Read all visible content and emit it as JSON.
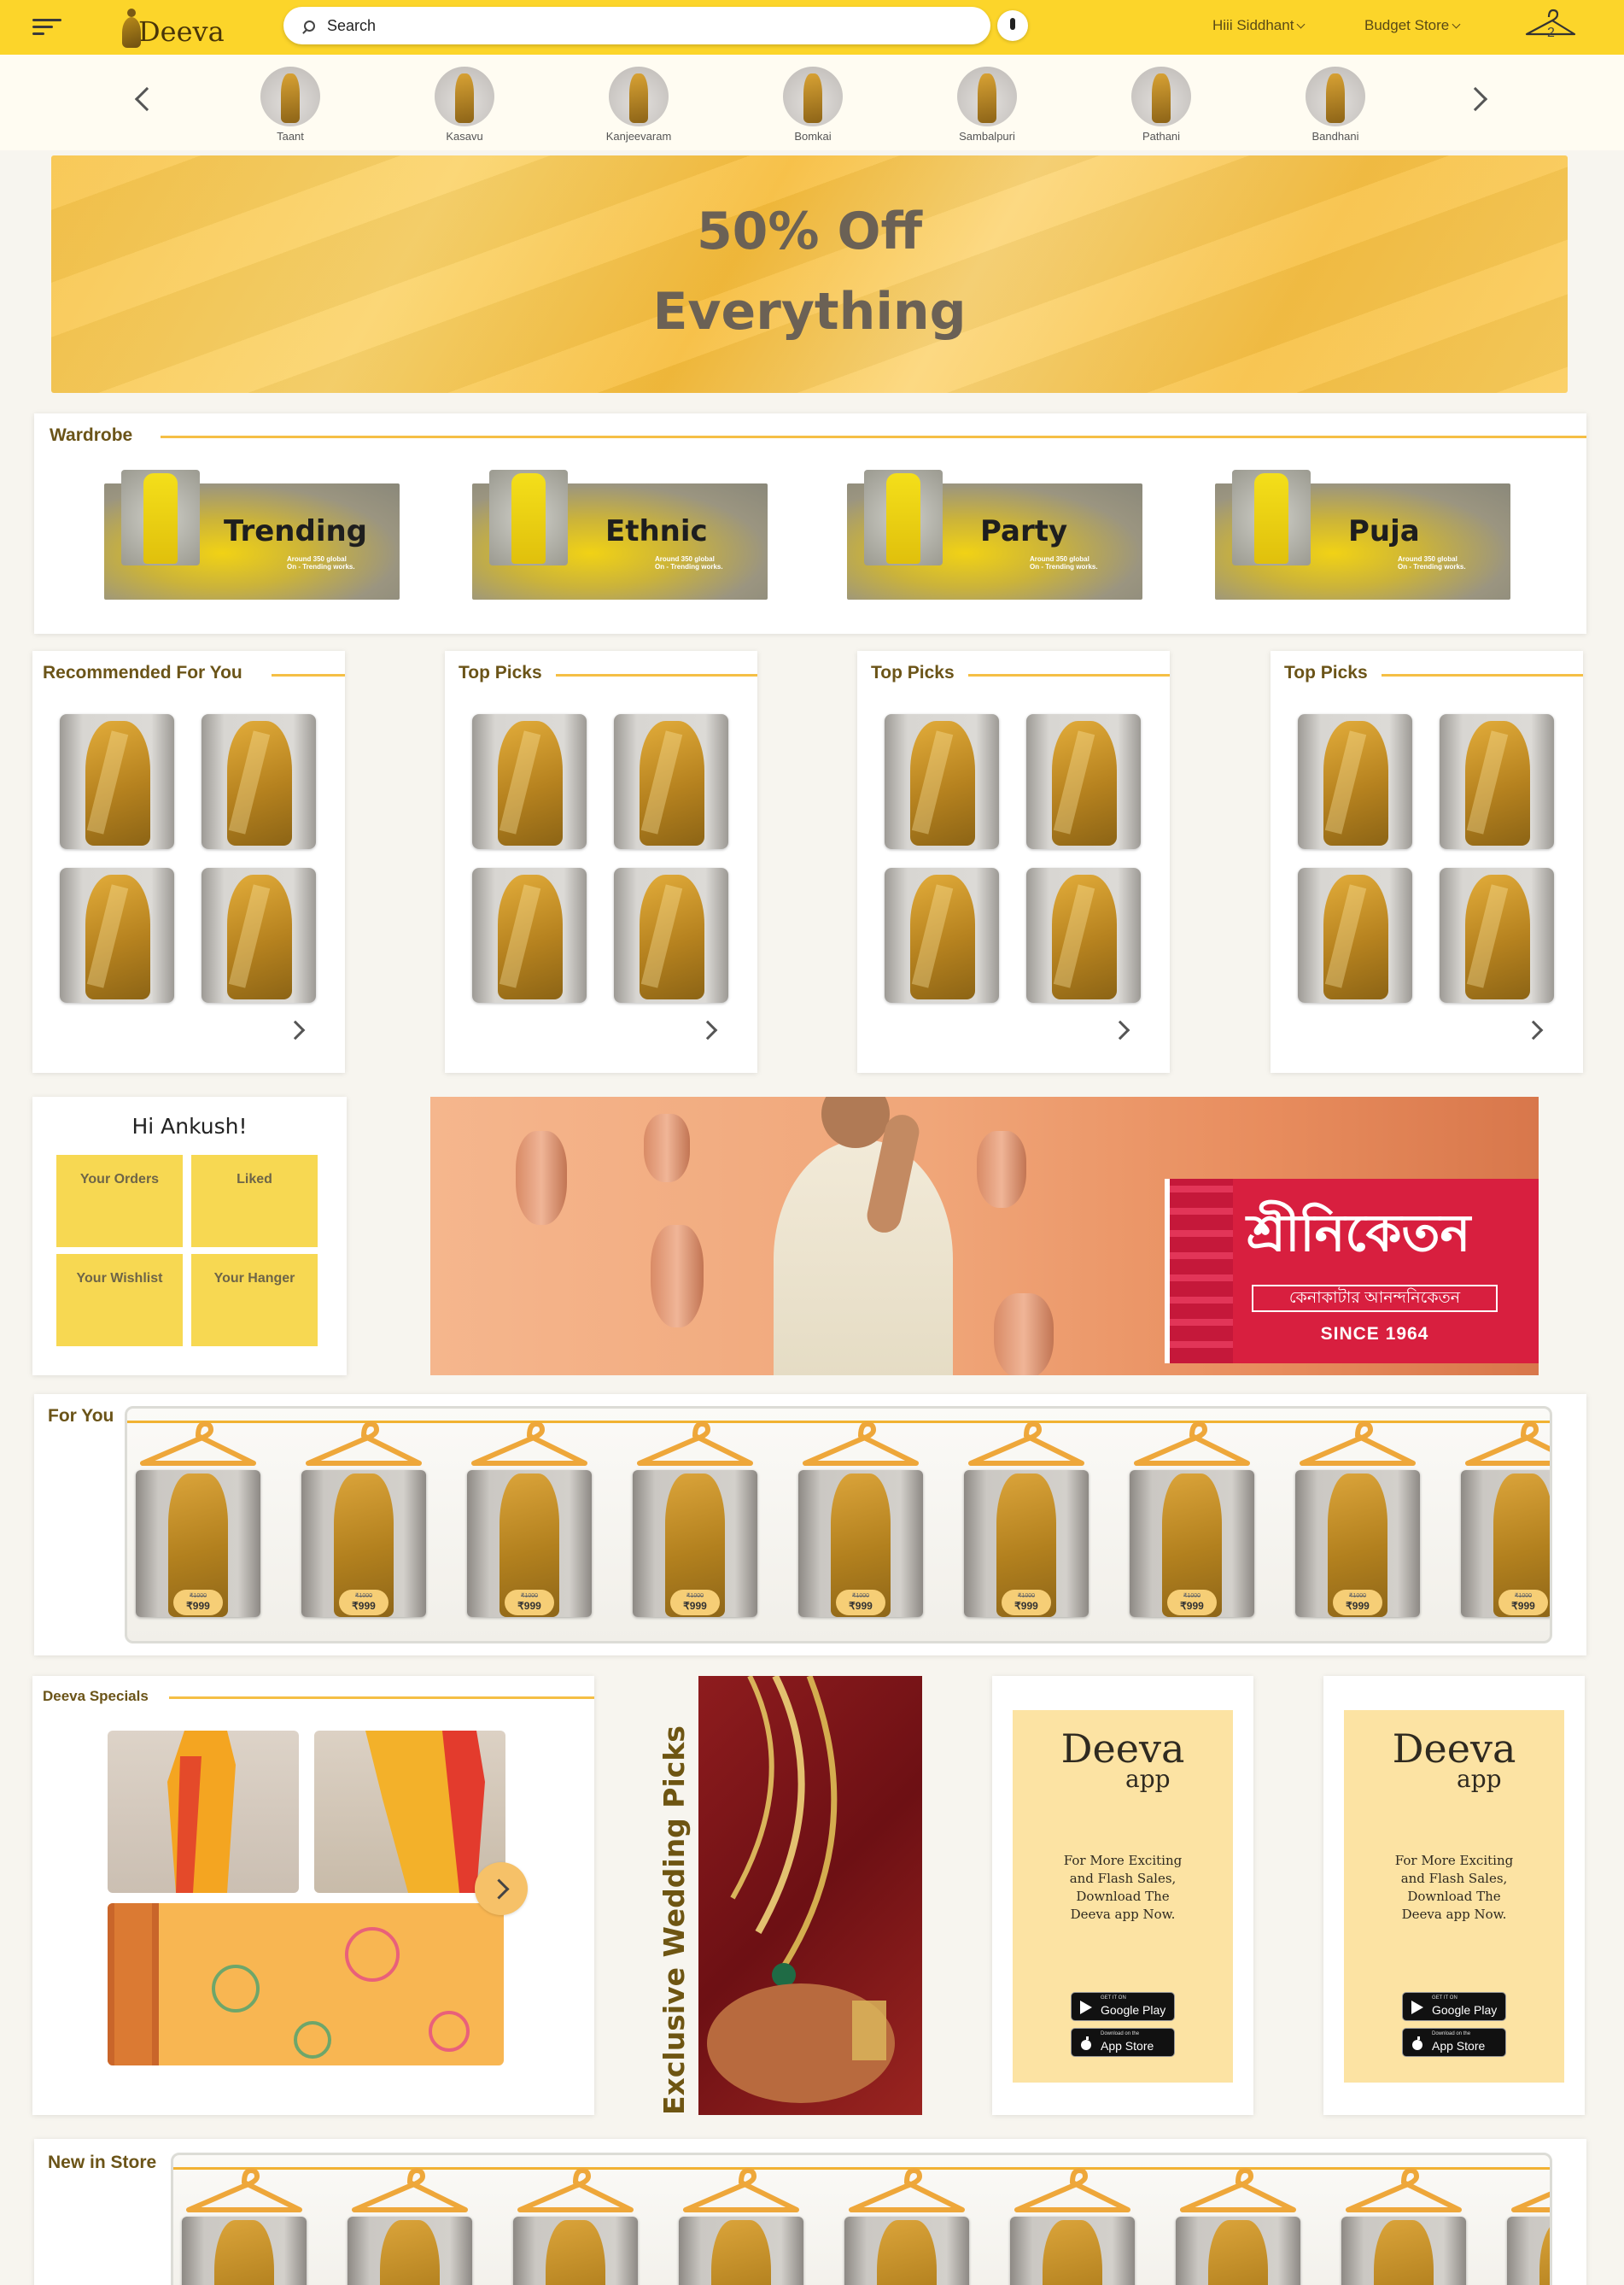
{
  "header": {
    "brand": "Deeva",
    "search_placeholder": "Search",
    "user_menu": "Hiii Siddhant",
    "store_menu": "Budget Store",
    "hanger_count": "2"
  },
  "categories": [
    "Taant",
    "Kasavu",
    "Kanjeevaram",
    "Bomkai",
    "Sambalpuri",
    "Pathani",
    "Bandhani"
  ],
  "hero": {
    "line1": "50% Off",
    "line2": "Everything"
  },
  "wardrobe": {
    "title": "Wardrobe",
    "items": [
      {
        "label": "Trending",
        "sub1": "Around 350 global",
        "sub2": "On - Trending works."
      },
      {
        "label": "Ethnic",
        "sub1": "Around 350 global",
        "sub2": "On - Trending works."
      },
      {
        "label": "Party",
        "sub1": "Around 350 global",
        "sub2": "On - Trending works."
      },
      {
        "label": "Puja",
        "sub1": "Around 350 global",
        "sub2": "On - Trending works."
      }
    ]
  },
  "pick_cards": [
    {
      "title": "Recommended For You"
    },
    {
      "title": "Top Picks"
    },
    {
      "title": "Top Picks"
    },
    {
      "title": "Top Picks"
    }
  ],
  "greeting": {
    "title": "Hi Ankush!",
    "tiles": [
      "Your Orders",
      "Liked",
      "Your Wishlist",
      "Your Hanger"
    ]
  },
  "banner": {
    "brand_bengali": "শ্রীনিকেতন",
    "tagline_bengali": "কেনাকাটার আনন্দনিকেতন",
    "since": "SINCE 1964"
  },
  "for_you": {
    "title": "For You",
    "items": [
      {
        "old_price": "₹1000",
        "price": "₹999"
      },
      {
        "old_price": "₹1000",
        "price": "₹999"
      },
      {
        "old_price": "₹1000",
        "price": "₹999"
      },
      {
        "old_price": "₹1000",
        "price": "₹999"
      },
      {
        "old_price": "₹1000",
        "price": "₹999"
      },
      {
        "old_price": "₹1000",
        "price": "₹999"
      },
      {
        "old_price": "₹1000",
        "price": "₹999"
      },
      {
        "old_price": "₹1000",
        "price": "₹999"
      },
      {
        "old_price": "₹1000",
        "price": "₹999"
      }
    ]
  },
  "specials": {
    "title": "Deeva Specials"
  },
  "wedding": {
    "label": "Exclusive Wedding Picks"
  },
  "app_promo": {
    "title": "Deeva",
    "subtitle": "app",
    "text": "For More Exciting and Flash Sales, Download The Deeva app Now.",
    "google_small": "GET IT ON",
    "google_big": "Google Play",
    "apple_small": "Download on the",
    "apple_big": "App Store"
  },
  "new_in_store": {
    "title": "New in Store"
  },
  "colors": {
    "accent": "#fcd52a",
    "tile": "#f7d852",
    "line": "#f5bf45"
  }
}
